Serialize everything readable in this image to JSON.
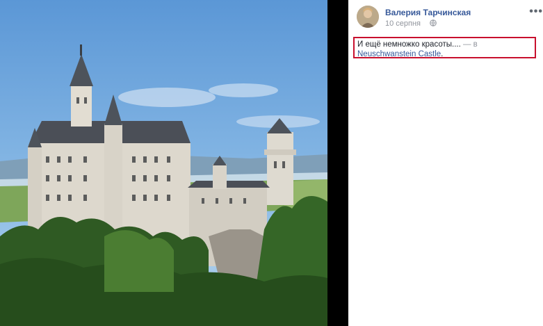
{
  "post": {
    "author": "Валерия Тарчинская",
    "date": "10 серпня",
    "text": "И ещё немножко красоты....",
    "location_sep": " — в ",
    "location": "Neuschwanstein Castle",
    "location_end": "."
  },
  "icons": {
    "more": "more-options-icon",
    "privacy": "globe-icon"
  },
  "colors": {
    "link": "#365899",
    "highlight_box": "#c8102e",
    "meta": "#90949c"
  }
}
